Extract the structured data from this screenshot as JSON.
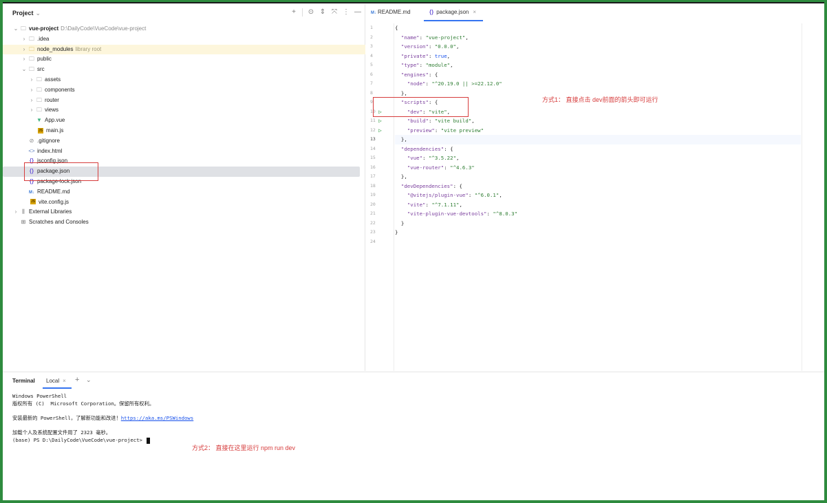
{
  "project_panel": {
    "title": "Project",
    "tree": [
      {
        "label": "vue-project",
        "note": "D:\\DailyCode\\VueCode\\vue-project"
      },
      {
        "label": ".idea"
      },
      {
        "label": "node_modules",
        "note": "library root"
      },
      {
        "label": "public"
      },
      {
        "label": "src"
      },
      {
        "label": "assets"
      },
      {
        "label": "components"
      },
      {
        "label": "router"
      },
      {
        "label": "views"
      },
      {
        "label": "App.vue"
      },
      {
        "label": "main.js"
      },
      {
        "label": ".gitignore"
      },
      {
        "label": "index.html"
      },
      {
        "label": "jsconfig.json"
      },
      {
        "label": "package.json"
      },
      {
        "label": "package-lock.json"
      },
      {
        "label": "README.md"
      },
      {
        "label": "vite.config.js"
      },
      {
        "label": "External Libraries"
      },
      {
        "label": "Scratches and Consoles"
      }
    ]
  },
  "editor": {
    "tabs": [
      {
        "label": "README.md"
      },
      {
        "label": "package.json"
      }
    ],
    "line_numbers": [
      "1",
      "2",
      "3",
      "4",
      "5",
      "6",
      "7",
      "8",
      "9",
      "10",
      "11",
      "12",
      "13",
      "14",
      "15",
      "16",
      "17",
      "18",
      "19",
      "20",
      "21",
      "22",
      "23",
      "24"
    ]
  },
  "annotations": {
    "method1": "方式1：  直接点击 dev前面的箭头即可运行",
    "method2": "方式2：  直接在这里运行 npm run dev"
  },
  "terminal": {
    "title": "Terminal",
    "tab": "Local",
    "lines": [
      "Windows PowerShell",
      "版权所有 (C)  Microsoft Corporation。保留所有权利。",
      "",
      "安装最新的 PowerShell，了解新功能和改进！",
      "",
      "加载个人及系统配置文件用了 2323 毫秒。",
      "(base) PS D:\\DailyCode\\VueCode\\vue-project> "
    ],
    "link": "https://aka.ms/PSWindows"
  },
  "colors": {
    "frame": "#2e8b3e",
    "annotation": "#d63b3b",
    "accent": "#3574f0",
    "run_icon": "#3fa34d"
  }
}
